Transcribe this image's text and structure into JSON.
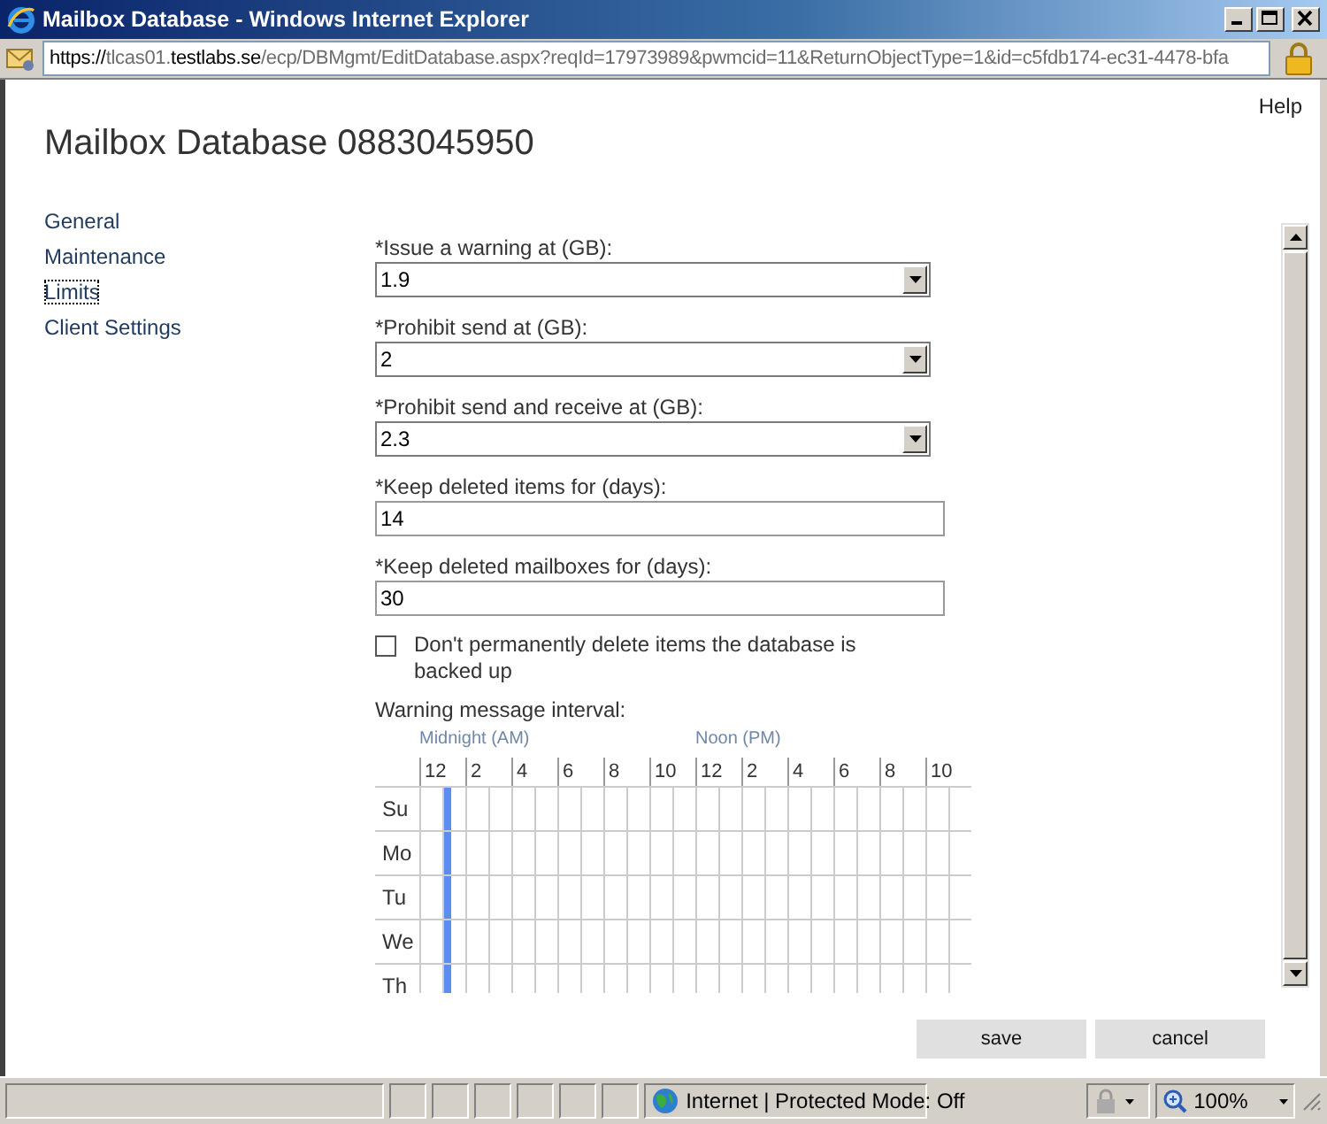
{
  "window": {
    "title": "Mailbox Database - Windows Internet Explorer"
  },
  "address_bar": {
    "url_parts": [
      {
        "text": "https://",
        "highlighted": true
      },
      {
        "text": "tlcas01.",
        "highlighted": false
      },
      {
        "text": "testlabs.se",
        "highlighted": true
      },
      {
        "text": "/ecp/DBMgmt/EditDatabase.aspx?reqId=17973989&pwmcid=11&ReturnObjectType=1&id=c5fdb174-ec31-4478-bfa",
        "highlighted": false
      }
    ]
  },
  "page": {
    "help": "Help",
    "title": "Mailbox Database 0883045950",
    "nav": [
      {
        "label": "General",
        "selected": false
      },
      {
        "label": "Maintenance",
        "selected": false
      },
      {
        "label": "Limits",
        "selected": true
      },
      {
        "label": "Client Settings",
        "selected": false
      }
    ],
    "fields": [
      {
        "kind": "dropdown",
        "label": "*Issue a warning at (GB):",
        "value": "1.9"
      },
      {
        "kind": "dropdown",
        "label": "*Prohibit send at (GB):",
        "value": "2"
      },
      {
        "kind": "dropdown",
        "label": "*Prohibit send and receive at (GB):",
        "value": "2.3"
      },
      {
        "kind": "text",
        "label": "*Keep deleted items for (days):",
        "value": "14"
      },
      {
        "kind": "text",
        "label": "*Keep deleted mailboxes for (days):",
        "value": "30"
      }
    ],
    "checkbox": {
      "label": "Don't permanently delete items the database is backed up",
      "checked": false
    },
    "interval": {
      "label": "Warning message interval:",
      "midnight": "Midnight (AM)",
      "noon": "Noon (PM)",
      "hours": [
        "12",
        "2",
        "4",
        "6",
        "8",
        "10",
        "12",
        "2",
        "4",
        "6",
        "8",
        "10"
      ],
      "days": [
        {
          "label": "Su",
          "marked": true
        },
        {
          "label": "Mo",
          "marked": true
        },
        {
          "label": "Tu",
          "marked": true
        },
        {
          "label": "We",
          "marked": true
        },
        {
          "label": "Th",
          "marked": true
        }
      ]
    },
    "buttons": [
      "save",
      "cancel"
    ]
  },
  "status_bar": {
    "zone": "Internet | Protected Mode: Off",
    "zoom": "100%"
  }
}
